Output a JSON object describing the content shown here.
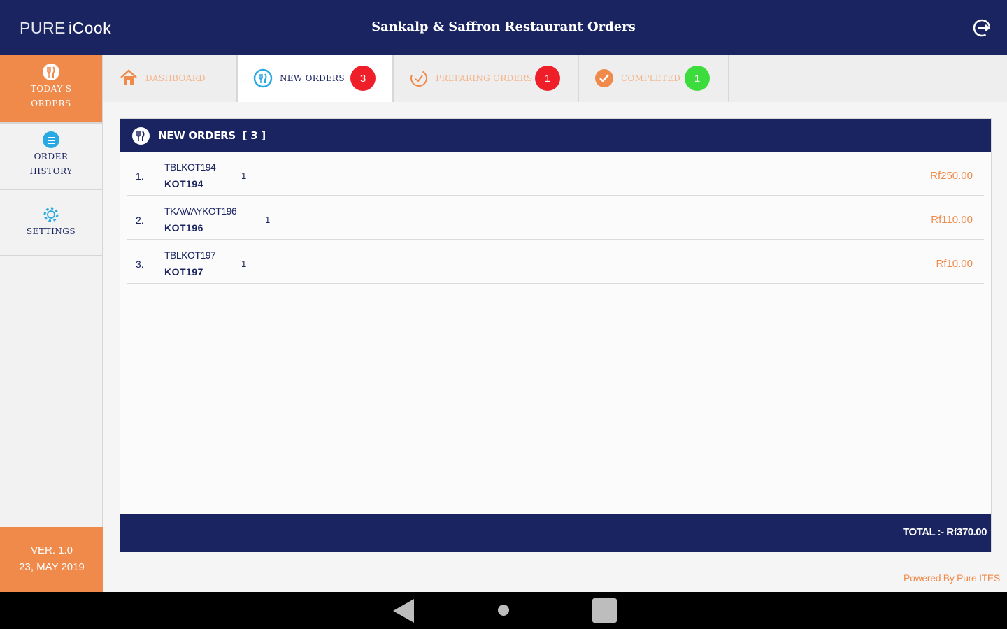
{
  "app": {
    "logo_part1": "PURE",
    "logo_part2": "iCook",
    "title": "Sankalp & Saffron Restaurant Orders",
    "logout_icon": "logout-icon"
  },
  "sidebar": {
    "items": [
      {
        "label_line1": "TODAY'S",
        "label_line2": "ORDERS",
        "icon": "cutlery-icon",
        "active": true
      },
      {
        "label_line1": "ORDER",
        "label_line2": "HISTORY",
        "icon": "list-icon",
        "active": false
      },
      {
        "label_line1": "SETTINGS",
        "label_line2": "",
        "icon": "gear-icon",
        "active": false
      }
    ],
    "version": "VER. 1.0",
    "date": "23, MAY 2019"
  },
  "tabs": [
    {
      "label": "DASHBOARD",
      "icon": "home-icon",
      "badge": null,
      "active": false
    },
    {
      "label": "NEW ORDERS",
      "icon": "cutlery-icon",
      "badge": "3",
      "active": true
    },
    {
      "label": "PREPARING ORDERS",
      "icon": "timer-icon",
      "badge": "1",
      "active": false
    },
    {
      "label": "COMPLETED",
      "icon": "check-icon",
      "badge": "1",
      "active": false
    }
  ],
  "panel": {
    "title": "NEW ORDERS",
    "count": "[ 3 ]",
    "rows": [
      {
        "num": "1.",
        "code": "TBLKOT194",
        "kot": "KOT194",
        "qty": "1",
        "amount": "Rf250.00"
      },
      {
        "num": "2.",
        "code": "TKAWAYKOT196",
        "kot": "KOT196",
        "qty": "1",
        "amount": "Rf110.00"
      },
      {
        "num": "3.",
        "code": "TBLKOT197",
        "kot": "KOT197",
        "qty": "1",
        "amount": "Rf10.00"
      }
    ],
    "total": "TOTAL :- Rf370.00"
  },
  "footer": {
    "powered": "Powered By Pure ITES"
  },
  "colors": {
    "navy": "#1a2460",
    "orange": "#f08a4b",
    "red_badge": "#ef1f2a",
    "green_badge": "#3ddc3d",
    "blue_accent": "#29a9e1"
  }
}
